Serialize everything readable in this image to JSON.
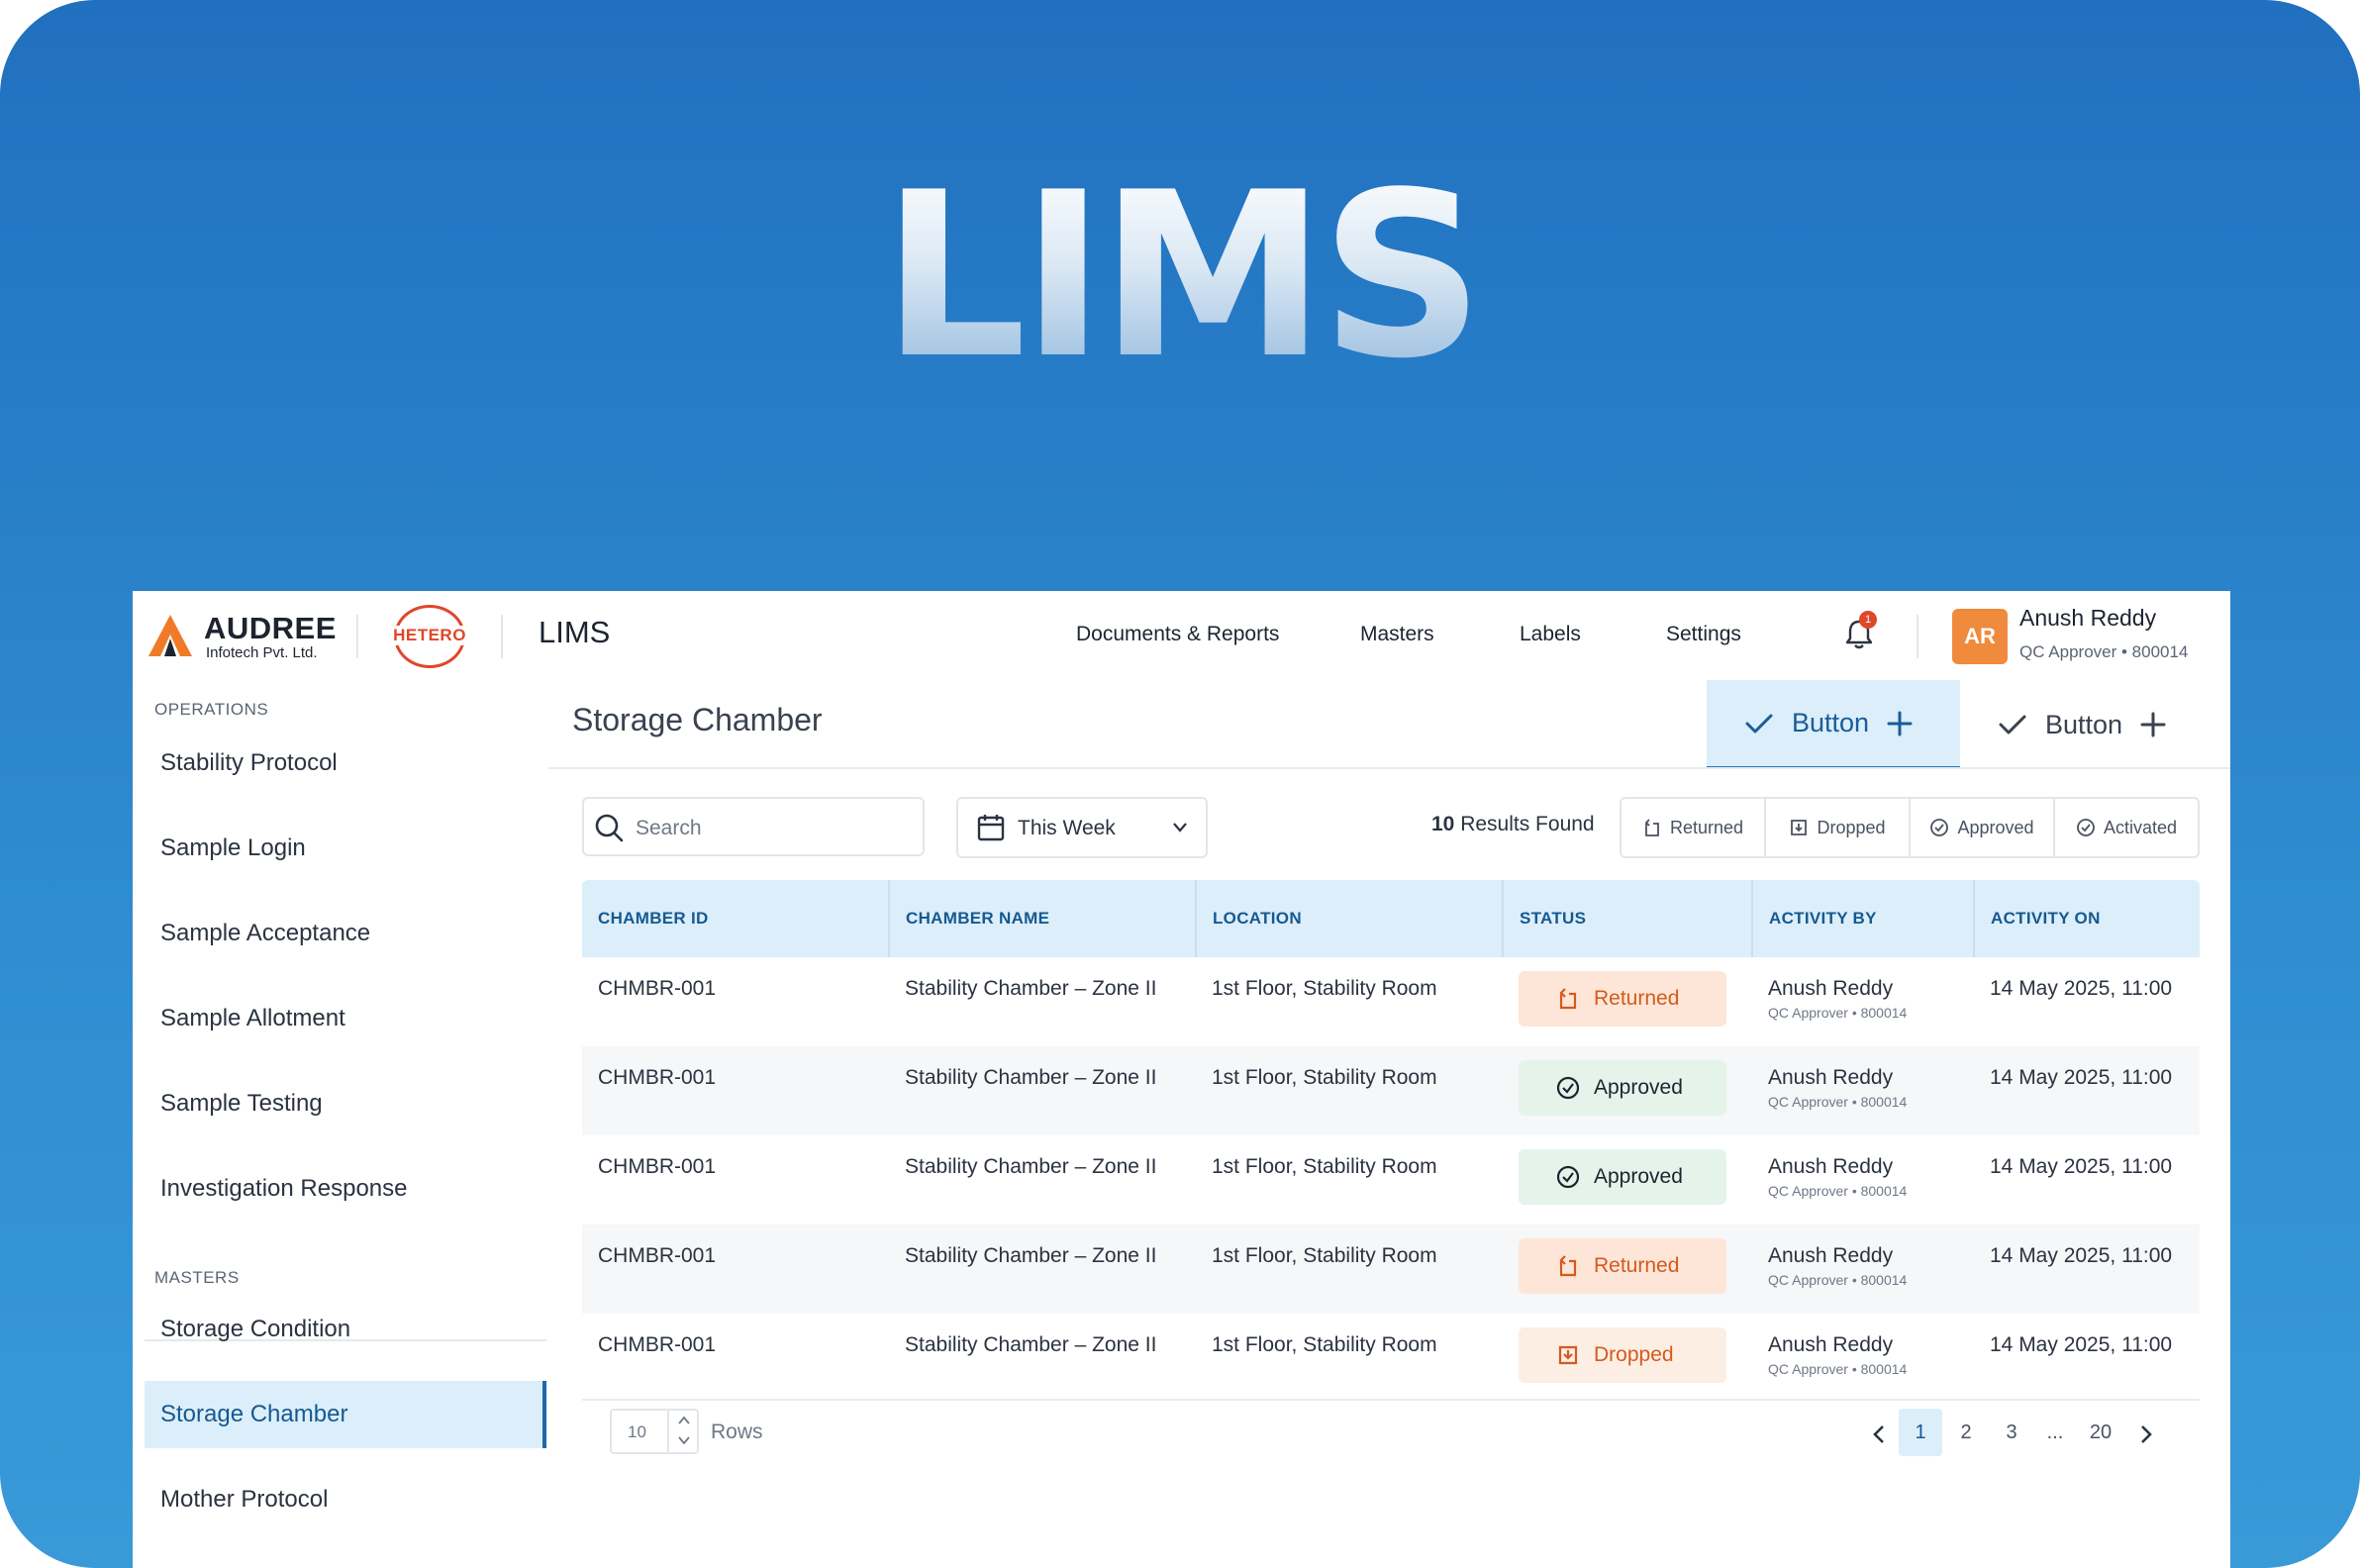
{
  "hero_title": "LIMS",
  "brand": {
    "name": "AUDREE",
    "subtitle": "Infotech Pvt. Ltd.",
    "partner": "HETERO"
  },
  "app_title": "LIMS",
  "nav": [
    "Documents & Reports",
    "Masters",
    "Labels",
    "Settings"
  ],
  "notifications": {
    "count": "1"
  },
  "user": {
    "initials": "AR",
    "name": "Anush Reddy",
    "role": "QC Approver • 800014"
  },
  "sidebar": {
    "operations_label": "OPERATIONS",
    "operations": [
      "Stability Protocol",
      "Sample Login",
      "Sample Acceptance",
      "Sample Allotment",
      "Sample Testing",
      "Investigation Response"
    ],
    "masters_label": "MASTERS",
    "masters": [
      "Storage Condition",
      "Storage Chamber",
      "Mother Protocol"
    ],
    "active": "Storage Chamber"
  },
  "page": {
    "title": "Storage Chamber",
    "buttons": [
      "Button",
      "Button"
    ]
  },
  "toolbar": {
    "search_placeholder": "Search",
    "date_filter": "This Week",
    "results_count": "10",
    "results_label": "Results Found",
    "filters": [
      "Returned",
      "Dropped",
      "Approved",
      "Activated"
    ]
  },
  "table": {
    "columns": [
      "CHAMBER ID",
      "CHAMBER NAME",
      "LOCATION",
      "STATUS",
      "ACTIVITY BY",
      "ACTIVITY ON"
    ],
    "rows": [
      {
        "id": "CHMBR-001",
        "name": "Stability Chamber – Zone II",
        "location": "1st Floor, Stability Room",
        "status": "Returned",
        "by": "Anush Reddy",
        "role": "QC Approver  • 800014",
        "on": "14 May 2025, 11:00"
      },
      {
        "id": "CHMBR-001",
        "name": "Stability Chamber – Zone II",
        "location": "1st Floor, Stability Room",
        "status": "Approved",
        "by": "Anush Reddy",
        "role": "QC Approver  • 800014",
        "on": "14 May 2025, 11:00"
      },
      {
        "id": "CHMBR-001",
        "name": "Stability Chamber – Zone II",
        "location": "1st Floor, Stability Room",
        "status": "Approved",
        "by": "Anush Reddy",
        "role": "QC Approver  • 800014",
        "on": "14 May 2025, 11:00"
      },
      {
        "id": "CHMBR-001",
        "name": "Stability Chamber – Zone II",
        "location": "1st Floor, Stability Room",
        "status": "Returned",
        "by": "Anush Reddy",
        "role": "QC Approver  • 800014",
        "on": "14 May 2025, 11:00"
      },
      {
        "id": "CHMBR-001",
        "name": "Stability Chamber – Zone II",
        "location": "1st Floor, Stability Room",
        "status": "Dropped",
        "by": "Anush Reddy",
        "role": "QC Approver  • 800014",
        "on": "14 May 2025, 11:00"
      }
    ]
  },
  "pagination": {
    "rows_per_page": "10",
    "rows_label": "Rows",
    "pages": [
      "1",
      "2",
      "3",
      "...",
      "20"
    ],
    "current": "1"
  },
  "colors": {
    "accent": "#1a5d99",
    "accent_bg": "#dbeefa",
    "returned": "#d45a1e",
    "approved_bg": "#e5f4ea",
    "avatar": "#f08a3c",
    "badge": "#e0462a"
  }
}
